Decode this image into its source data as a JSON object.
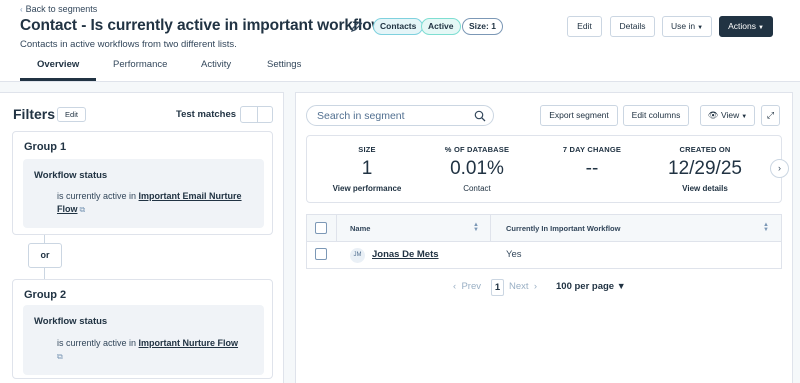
{
  "header": {
    "back_label": "Back to segments",
    "title": "Contact - Is currently active in important workflow",
    "badges": {
      "contacts": "Contacts",
      "active": "Active",
      "size": "Size: 1"
    },
    "subtitle": "Contacts in active workflows from two different lists.",
    "buttons": {
      "edit": "Edit",
      "details": "Details",
      "use_in": "Use in",
      "actions": "Actions"
    }
  },
  "tabs": [
    "Overview",
    "Performance",
    "Activity",
    "Settings"
  ],
  "filters": {
    "title": "Filters",
    "edit_label": "Edit",
    "test_matches_label": "Test matches",
    "or_label": "or",
    "groups": [
      {
        "title": "Group 1",
        "criteria_label": "Workflow status",
        "criteria_prefix": "is currently active in",
        "criteria_link": "Important Email Nurture Flow"
      },
      {
        "title": "Group 2",
        "criteria_label": "Workflow status",
        "criteria_prefix": "is currently active in",
        "criteria_link": "Important Nurture Flow"
      }
    ]
  },
  "records": {
    "search_placeholder": "Search in segment",
    "export_label": "Export segment",
    "edit_columns_label": "Edit columns",
    "view_label": "View",
    "stats": [
      {
        "label": "SIZE",
        "value": "1",
        "sub": "View performance"
      },
      {
        "label": "% OF DATABASE",
        "value": "0.01%",
        "sub": "Contact"
      },
      {
        "label": "7 DAY CHANGE",
        "value": "--",
        "sub": ""
      },
      {
        "label": "CREATED ON",
        "value": "12/29/25",
        "sub": "View details"
      }
    ],
    "columns": [
      "Name",
      "Currently In Important Workflow"
    ],
    "rows": [
      {
        "initials": "JM",
        "name": "Jonas De Mets",
        "value": "Yes"
      }
    ],
    "pagination": {
      "prev": "Prev",
      "page": "1",
      "next": "Next",
      "per_page": "100 per page"
    }
  }
}
